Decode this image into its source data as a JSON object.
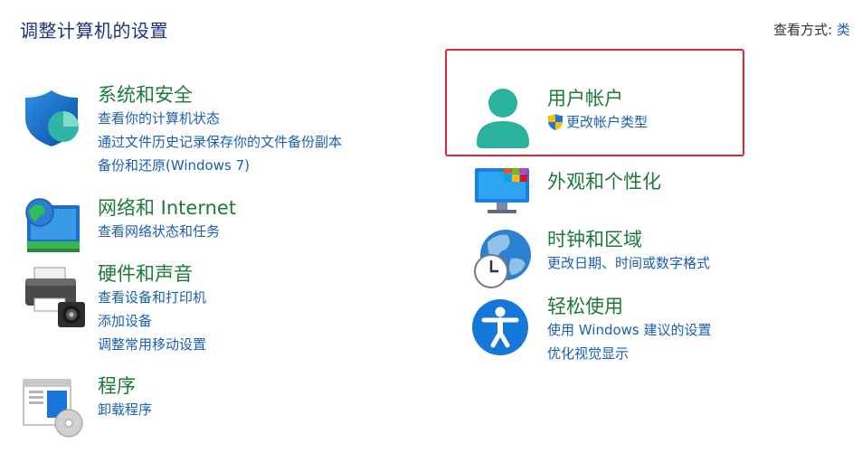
{
  "page_title": "调整计算机的设置",
  "view_mode": {
    "label": "查看方式:",
    "value": "类"
  },
  "categories": {
    "system_security": {
      "title": "系统和安全",
      "links": [
        "查看你的计算机状态",
        "通过文件历史记录保存你的文件备份副本",
        "备份和还原(Windows 7)"
      ]
    },
    "network": {
      "title": "网络和 Internet",
      "links": [
        "查看网络状态和任务"
      ]
    },
    "hardware": {
      "title": "硬件和声音",
      "links": [
        "查看设备和打印机",
        "添加设备",
        "调整常用移动设置"
      ]
    },
    "programs": {
      "title": "程序",
      "links": [
        "卸载程序"
      ]
    },
    "user_accounts": {
      "title": "用户帐户",
      "links": [
        "更改帐户类型"
      ]
    },
    "appearance": {
      "title": "外观和个性化",
      "links": []
    },
    "clock_region": {
      "title": "时钟和区域",
      "links": [
        "更改日期、时间或数字格式"
      ]
    },
    "ease_of_access": {
      "title": "轻松使用",
      "links": [
        "使用 Windows 建议的设置",
        "优化视觉显示"
      ]
    }
  },
  "colors": {
    "category_title": "#1e7a3a",
    "link": "#1a5fb4",
    "page_title": "#1e3287",
    "highlight": "#e3262b"
  }
}
